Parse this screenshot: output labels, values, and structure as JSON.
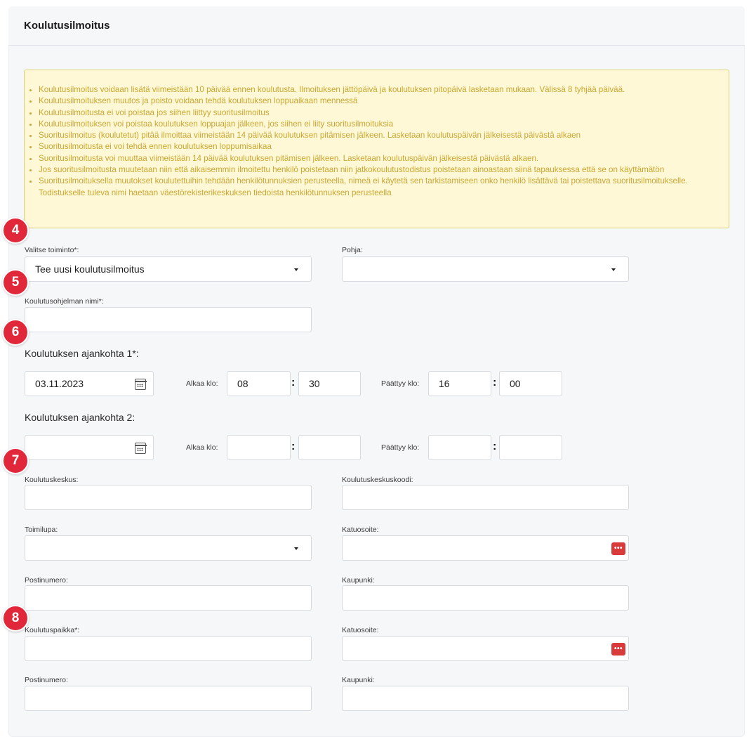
{
  "header": {
    "title": "Koulutusilmoitus"
  },
  "notice": {
    "items": [
      "Koulutusilmoitus voidaan lisätä viimeistään 10 päivää ennen koulutusta. Ilmoituksen jättöpäivä ja koulutuksen pitopäivä lasketaan mukaan. Välissä 8 tyhjää päivää.",
      "Koulutusilmoituksen muutos ja poisto voidaan tehdä koulutuksen loppuaikaan mennessä",
      "Koulutusilmoitusta ei voi poistaa jos siihen liittyy suoritusilmoitus",
      "Koulutusilmoituksen voi poistaa koulutuksen loppuajan jälkeen, jos siihen ei liity suoritusilmoituksia",
      "Suoritusilmoitus (koulutetut) pitää ilmoittaa viimeistään 14 päivää koulutuksen pitämisen jälkeen. Lasketaan koulutuspäivän jälkeisestä päivästä alkaen",
      "Suoritusilmoitusta ei voi tehdä ennen koulutuksen loppumisaikaa",
      "Suoritusilmoitusta voi muuttaa viimeistään 14 päivää koulutuksen pitämisen jälkeen. Lasketaan koulutuspäivän jälkeisestä päivästä alkaen.",
      "Jos suoritusilmoitusta muutetaan niin että aikaisemmin ilmoitettu henkilö poistetaan niin jatkokoulutustodistus poistetaan ainoastaan siinä tapauksessa että se on käyttämätön",
      "Suoritusilmoituksella muutokset koulutettuihin tehdään henkilötunnuksien perusteella, nimeä ei käytetä sen tarkistamiseen onko henkilö lisättävä tai poistettava suoritusilmoitukselle. Todistukselle tuleva nimi haetaan väestörekisterikeskuksen tiedoista henkilötunnuksen perusteella"
    ]
  },
  "markers": [
    "4",
    "5",
    "6",
    "7",
    "8"
  ],
  "form": {
    "action": {
      "label": "Valitse toiminto*:",
      "value": "Tee uusi koulutusilmoitus"
    },
    "template": {
      "label": "Pohja:",
      "value": ""
    },
    "program_name": {
      "label": "Koulutusohjelman nimi*:",
      "value": ""
    },
    "time1": {
      "title": "Koulutuksen ajankohta 1*:",
      "date": "03.11.2023",
      "start_label": "Alkaa klo:",
      "start_hour": "08",
      "start_min": "30",
      "end_label": "Päättyy klo:",
      "end_hour": "16",
      "end_min": "00"
    },
    "time2": {
      "title": "Koulutuksen ajankohta 2:",
      "date": "",
      "start_label": "Alkaa klo:",
      "start_hour": "",
      "start_min": "",
      "end_label": "Päättyy klo:",
      "end_hour": "",
      "end_min": ""
    },
    "colon": ":",
    "center": {
      "label": "Koulutuskeskus:",
      "value": ""
    },
    "center_code": {
      "label": "Koulutuskeskuskoodi:",
      "value": ""
    },
    "license": {
      "label": "Toimilupa:",
      "value": ""
    },
    "street1": {
      "label": "Katuosoite:",
      "value": ""
    },
    "postal1": {
      "label": "Postinumero:",
      "value": ""
    },
    "city1": {
      "label": "Kaupunki:",
      "value": ""
    },
    "venue": {
      "label": "Koulutuspaikka*:",
      "value": ""
    },
    "street2": {
      "label": "Katuosoite:",
      "value": ""
    },
    "postal2": {
      "label": "Postinumero:",
      "value": ""
    },
    "city2": {
      "label": "Kaupunki:",
      "value": ""
    },
    "lookup_icon_text": "•••"
  },
  "colors": {
    "marker": "#e0283a",
    "notice_bg": "#fff8d6",
    "notice_text": "#c9a630",
    "lookup": "#d93a3a"
  }
}
